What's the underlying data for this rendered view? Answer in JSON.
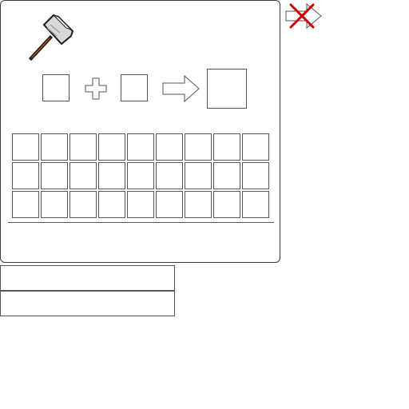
{
  "anvil": {
    "icon": "hammer-icon",
    "left_slot_value": "",
    "right_slot_value": "",
    "result_slot_value": "",
    "plus_icon": "plus-icon",
    "arrow_icon": "arrow-right-icon"
  },
  "inventory": {
    "rows": 3,
    "columns": 9,
    "slots": [
      "",
      "",
      "",
      "",
      "",
      "",
      "",
      "",
      "",
      "",
      "",
      "",
      "",
      "",
      "",
      "",
      "",
      "",
      "",
      "",
      "",
      "",
      "",
      "",
      "",
      "",
      ""
    ]
  },
  "fields": [
    {
      "value": "",
      "placeholder": ""
    },
    {
      "value": "",
      "placeholder": ""
    }
  ],
  "close_control": {
    "icon": "close-icon",
    "cross_color": "#cc0000"
  }
}
